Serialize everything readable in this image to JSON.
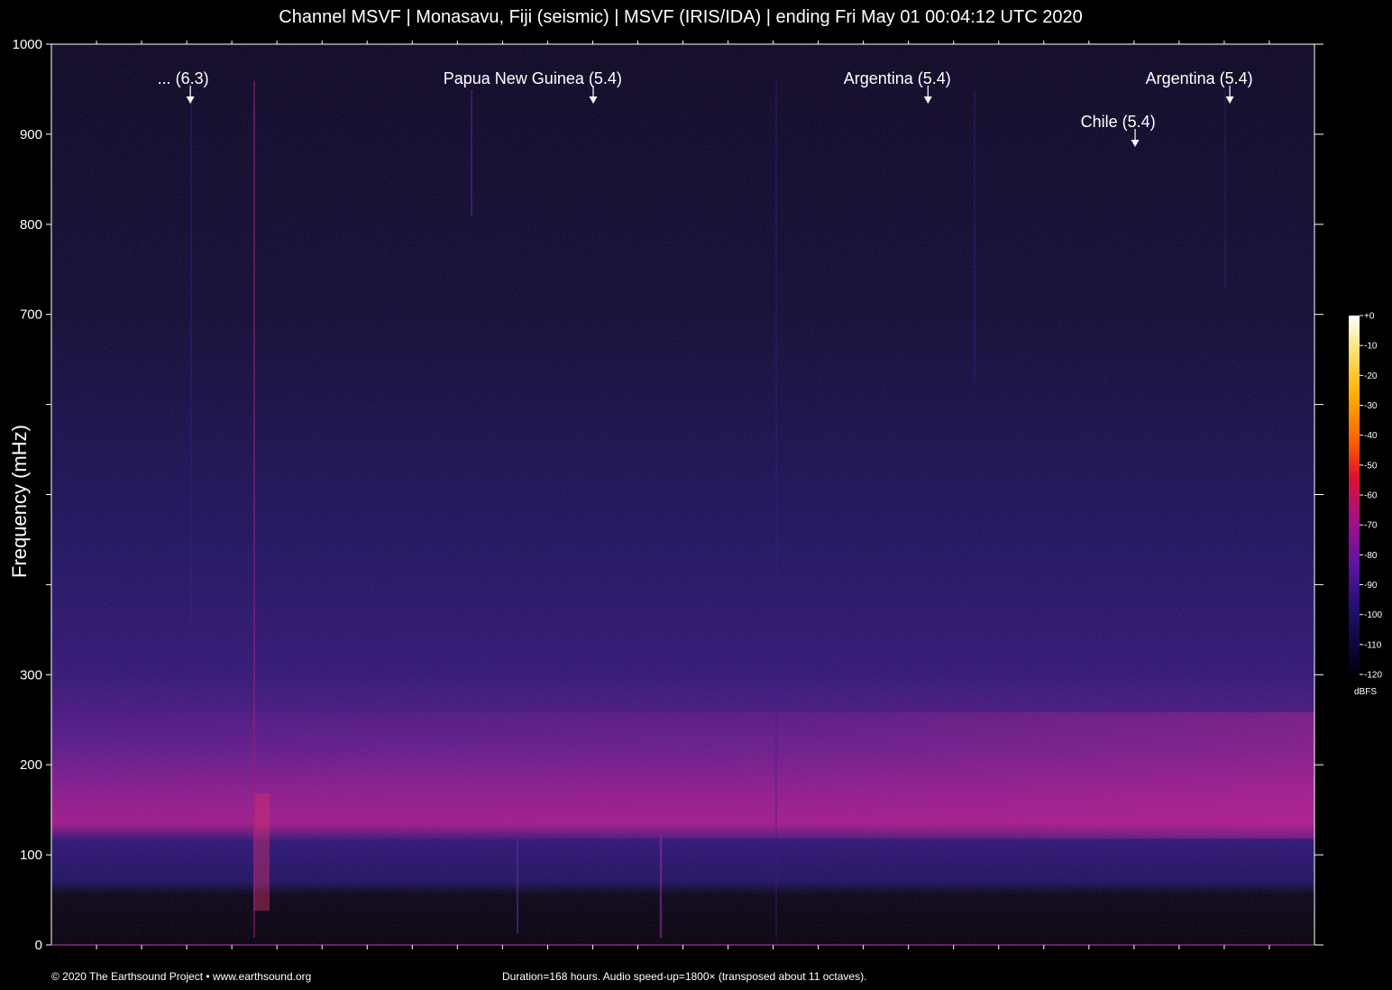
{
  "chart_data": {
    "type": "heatmap",
    "title": "Channel MSVF | Monasavu, Fiji (seismic) | MSVF (IRIS/IDA) | ending Fri May 01 00:04:12 UTC 2020",
    "ylabel": "Frequency (mHz)",
    "ylim": [
      0,
      1000
    ],
    "y_ticks": [
      0,
      100,
      200,
      300,
      400,
      500,
      600,
      700,
      800,
      900,
      1000
    ],
    "y_tick_labels": [
      "0",
      "100",
      "200",
      "300",
      "",
      "",
      "",
      "700",
      "800",
      "900",
      "1000"
    ],
    "duration_hours": 168,
    "events": [
      {
        "label": "... (6.3)",
        "time_fraction": 0.11,
        "row": 1
      },
      {
        "label": "Papua New Guinea (5.4)",
        "time_fraction": 0.429,
        "row": 1
      },
      {
        "label": "Argentina (5.4)",
        "time_fraction": 0.694,
        "row": 1
      },
      {
        "label": "Argentina (5.4)",
        "time_fraction": 0.933,
        "row": 1
      },
      {
        "label": "Chile (5.4)",
        "time_fraction": 0.858,
        "row": 2
      }
    ],
    "colorbar": {
      "unit": "dBFS",
      "ticks": [
        0,
        -10,
        -20,
        -30,
        -40,
        -50,
        -60,
        -70,
        -80,
        -90,
        -100,
        -110,
        -120
      ],
      "tick_labels": [
        "+0",
        "-10",
        "-20",
        "-30",
        "-40",
        "-50",
        "-60",
        "-70",
        "-80",
        "-90",
        "-100",
        "-110",
        "-120"
      ],
      "range": [
        -120,
        0
      ]
    },
    "background_color": "#000000",
    "colormap": [
      "#000000",
      "#0a0630",
      "#2a0e6e",
      "#6a1aa0",
      "#b0208a",
      "#e0205a",
      "#ff3a1a",
      "#ff8a00",
      "#ffd000",
      "#ffffff"
    ]
  },
  "footer": {
    "copyright": "© 2020 The Earthsound Project • www.earthsound.org",
    "duration_note": "Duration=168 hours. Audio speed-up=1800× (transposed about 11 octaves)."
  }
}
